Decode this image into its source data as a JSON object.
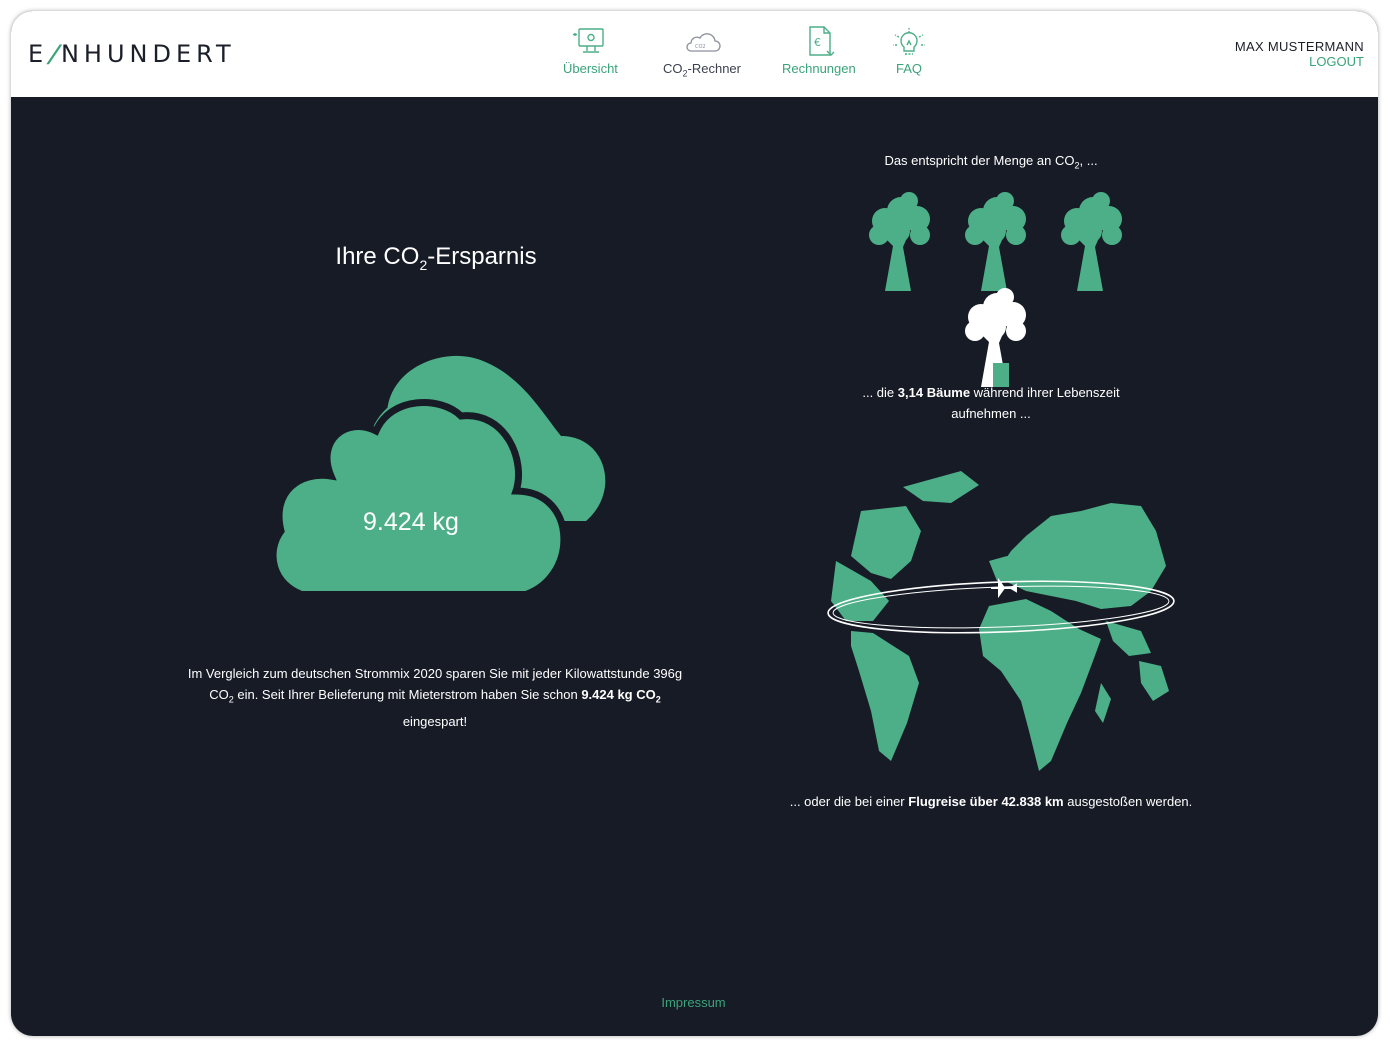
{
  "brand": {
    "logo_left": "E",
    "logo_right": "NHUNDERT"
  },
  "nav": {
    "overview": "Übersicht",
    "co2_prefix": "CO",
    "co2_sub": "2",
    "co2_suffix": "-Rechner",
    "invoices": "Rechnungen",
    "faq": "FAQ"
  },
  "user": {
    "name": "MAX MUSTERMANN",
    "logout": "LOGOUT"
  },
  "savings": {
    "title_prefix": "Ihre CO",
    "title_sub": "2",
    "title_suffix": "-Ersparnis",
    "value": "9.424 kg",
    "text_part1": "Im Vergleich zum deutschen Strommix 2020 sparen Sie mit jeder Kilowattstunde 396g",
    "text_co": "CO",
    "text_sub": "2",
    "text_part2": " ein. Seit Ihrer Belieferung mit Mieterstrom haben Sie schon ",
    "text_bold_value": "9.424 kg CO",
    "text_bold_sub": "2",
    "text_part3": "eingespart!"
  },
  "equivalent": {
    "intro_prefix": "Das entspricht der Menge an CO",
    "intro_sub": "2",
    "intro_suffix": ", ...",
    "trees_prefix": "... die ",
    "trees_bold": "3,14 Bäume",
    "trees_suffix": " während ihrer Lebenszeit",
    "trees_line2": "aufnehmen ...",
    "flight_prefix": "... oder die bei einer ",
    "flight_bold": "Flugreise über 42.838 km",
    "flight_suffix": " ausgestoßen werden."
  },
  "trees_value": 3.14,
  "footer": {
    "impressum": "Impressum"
  },
  "colors": {
    "accent": "#4caf87",
    "background": "#171b26",
    "topbar": "#ffffff"
  }
}
